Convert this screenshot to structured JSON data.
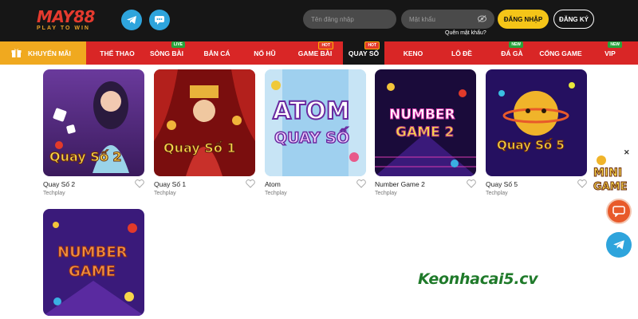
{
  "header": {
    "logo_text": "MAY88",
    "logo_tagline": "PLAY TO WIN",
    "username_placeholder": "Tên đăng nhập",
    "password_placeholder": "Mật khẩu",
    "forgot_password": "Quên mật khẩu?",
    "login_label": "ĐĂNG NHẬP",
    "register_label": "ĐĂNG KÝ"
  },
  "nav": {
    "promo_label": "KHUYẾN MÃI",
    "items": [
      {
        "label": "THỂ THAO",
        "badge": ""
      },
      {
        "label": "SÒNG BÀI",
        "badge": "LIVE"
      },
      {
        "label": "BẮN CÁ",
        "badge": ""
      },
      {
        "label": "NỔ HŨ",
        "badge": ""
      },
      {
        "label": "GAME BÀI",
        "badge": "HOT"
      },
      {
        "label": "QUAY SỐ",
        "badge": "HOT"
      },
      {
        "label": "KENO",
        "badge": ""
      },
      {
        "label": "LÔ ĐỀ",
        "badge": ""
      },
      {
        "label": "ĐÁ GÀ",
        "badge": "NEW"
      },
      {
        "label": "CỔNG GAME",
        "badge": ""
      },
      {
        "label": "VIP",
        "badge": "NEW"
      }
    ]
  },
  "games": [
    {
      "name": "Quay Số 2",
      "provider": "Techplay",
      "art_text": "Quay Số 2"
    },
    {
      "name": "Quay Số 1",
      "provider": "Techplay",
      "art_text": "Quay Số 1"
    },
    {
      "name": "Atom",
      "provider": "Techplay",
      "art_text": "ATOM",
      "art_text_2": "QUAY SỐ"
    },
    {
      "name": "Number Game 2",
      "provider": "Techplay",
      "art_text": "NUMBER",
      "art_text_2": "GAME 2"
    },
    {
      "name": "Quay Số 5",
      "provider": "Techplay",
      "art_text": "Quay Số 5"
    },
    {
      "name": "",
      "provider": "",
      "art_text": "NUMBER",
      "art_text_2": "GAME"
    }
  ],
  "side": {
    "mini_game_line1": "MINI",
    "mini_game_line2": "GAME"
  },
  "watermark": "Keonhacai5.cv",
  "colors": {
    "header_bg": "#161616",
    "nav_bg": "#d92626",
    "promo_bg": "#f0a91f",
    "login_bg": "#f5c518",
    "telegram": "#2ea4dc"
  }
}
